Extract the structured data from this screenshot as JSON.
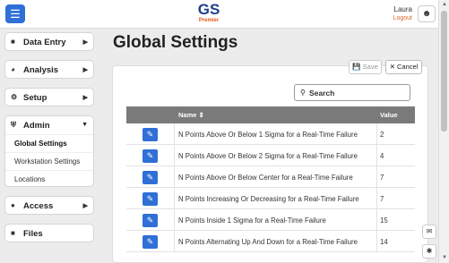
{
  "header": {
    "logo_main": "GS",
    "logo_sub": "Premier",
    "user_name": "Laura",
    "logout_label": "Logout"
  },
  "sidebar": {
    "items": [
      {
        "label": "Data Entry",
        "icon": "folder-icon"
      },
      {
        "label": "Analysis",
        "icon": "pie-chart-icon"
      },
      {
        "label": "Setup",
        "icon": "gear-icon"
      }
    ],
    "admin": {
      "label": "Admin",
      "icon": "shield-icon",
      "sub_items": [
        "Global Settings",
        "Workstation Settings",
        "Locations"
      ]
    },
    "bottom_items": [
      {
        "label": "Access",
        "icon": "user-icon"
      },
      {
        "label": "Files",
        "icon": "folder-icon"
      }
    ]
  },
  "page": {
    "title": "Global Settings",
    "save_label": "Save",
    "cancel_label": "Cancel",
    "search_placeholder": "Search"
  },
  "table": {
    "headers": {
      "name": "Name",
      "value": "Value"
    },
    "rows": [
      {
        "name": "N Points Above Or Below 1 Sigma for a Real-Time Failure",
        "value": "2"
      },
      {
        "name": "N Points Above Or Below 2 Sigma for a Real-Time Failure",
        "value": "4"
      },
      {
        "name": "N Points Above Or Below Center for a Real-Time Failure",
        "value": "7"
      },
      {
        "name": "N Points Increasing Or Decreasing for a Real-Time Failure",
        "value": "7"
      },
      {
        "name": "N Points Inside 1 Sigma for a Real-Time Failure",
        "value": "15"
      },
      {
        "name": "N Points Alternating Up And Down for a Real-Time Failure",
        "value": "14"
      }
    ]
  },
  "colors": {
    "accent": "#2f6fd6",
    "logo_blue": "#1f3f8c",
    "logo_orange": "#e05a1a",
    "table_header": "#7a7a7a"
  }
}
